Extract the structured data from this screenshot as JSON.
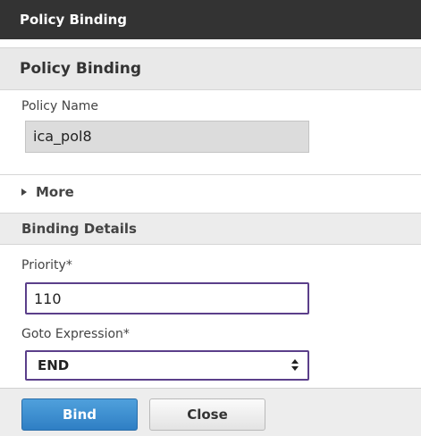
{
  "window": {
    "title": "Policy Binding"
  },
  "section": {
    "title": "Policy Binding"
  },
  "policy_name": {
    "label": "Policy Name",
    "value": "ica_pol8"
  },
  "more": {
    "label": "More"
  },
  "binding_details": {
    "title": "Binding Details",
    "priority": {
      "label": "Priority*",
      "value": "110"
    },
    "goto_expression": {
      "label": "Goto Expression*",
      "selected": "END"
    }
  },
  "footer": {
    "bind_label": "Bind",
    "close_label": "Close"
  },
  "colors": {
    "titlebar": "#333333",
    "primary_button": "#3a8ad0",
    "input_focus_border": "#5b3f8a"
  }
}
